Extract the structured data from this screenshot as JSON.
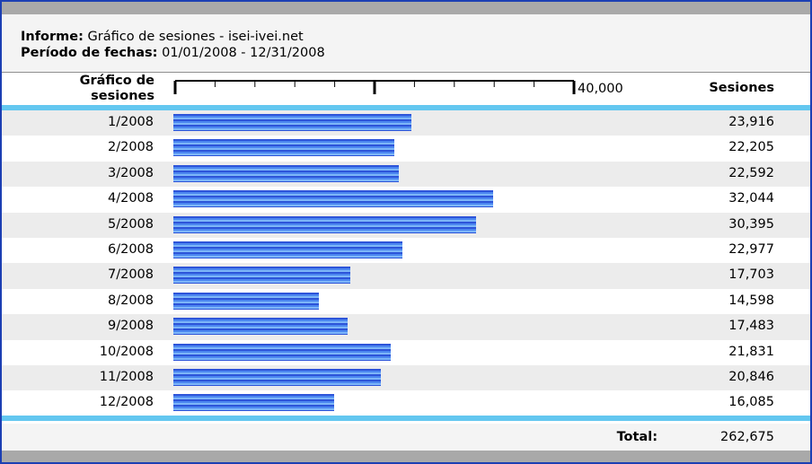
{
  "report": {
    "informe_label": "Informe:",
    "informe_value": "Gráfico de sesiones - isei-ivei.net",
    "period_label": "Período de fechas:",
    "period_value": "01/01/2008 - 12/31/2008"
  },
  "columns": {
    "chart_label": "Gráfico de sesiones",
    "axis_max_label": "40,000",
    "sessions_label": "Sesiones"
  },
  "rows": [
    {
      "month": "1/2008",
      "value": "23,916"
    },
    {
      "month": "2/2008",
      "value": "22,205"
    },
    {
      "month": "3/2008",
      "value": "22,592"
    },
    {
      "month": "4/2008",
      "value": "32,044"
    },
    {
      "month": "5/2008",
      "value": "30,395"
    },
    {
      "month": "6/2008",
      "value": "22,977"
    },
    {
      "month": "7/2008",
      "value": "17,703"
    },
    {
      "month": "8/2008",
      "value": "14,598"
    },
    {
      "month": "9/2008",
      "value": "17,483"
    },
    {
      "month": "10/2008",
      "value": "21,831"
    },
    {
      "month": "11/2008",
      "value": "20,846"
    },
    {
      "month": "12/2008",
      "value": "16,085"
    }
  ],
  "footer": {
    "total_label": "Total:",
    "total_value": "262,675"
  },
  "colors": {
    "frame": "#1c3fb3",
    "accent_line": "#63c7f0",
    "bar_dark": "#2d54d9",
    "bar_light": "#7db6f8"
  },
  "chart_data": {
    "type": "bar",
    "orientation": "horizontal",
    "categories": [
      "1/2008",
      "2/2008",
      "3/2008",
      "4/2008",
      "5/2008",
      "6/2008",
      "7/2008",
      "8/2008",
      "9/2008",
      "10/2008",
      "11/2008",
      "12/2008"
    ],
    "values": [
      23916,
      22205,
      22592,
      32044,
      30395,
      22977,
      17703,
      14598,
      17483,
      21831,
      20846,
      16085
    ],
    "xlim": [
      0,
      40000
    ]
  }
}
